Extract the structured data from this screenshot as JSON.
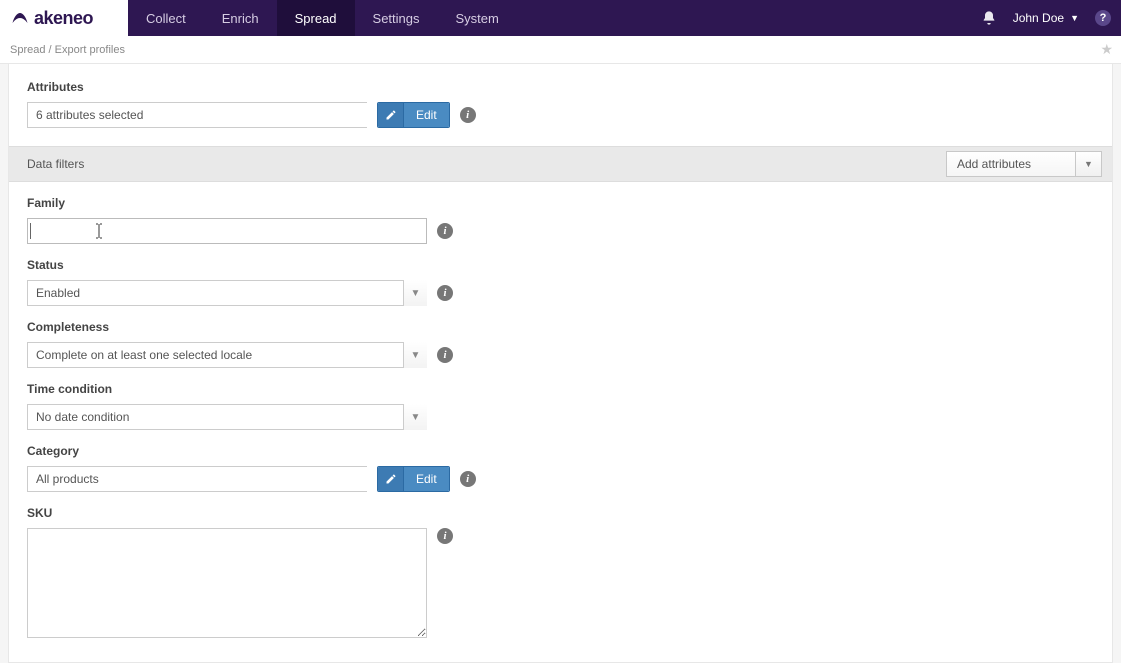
{
  "brand": "akeneo",
  "nav": {
    "items": [
      "Collect",
      "Enrich",
      "Spread",
      "Settings",
      "System"
    ],
    "active": "Spread"
  },
  "user": {
    "name": "John Doe"
  },
  "breadcrumb": {
    "root": "Spread",
    "page": "Export profiles"
  },
  "attributes": {
    "label": "Attributes",
    "value": "6 attributes selected",
    "edit": "Edit"
  },
  "filters": {
    "title": "Data filters",
    "add_button": "Add attributes"
  },
  "family": {
    "label": "Family",
    "value": ""
  },
  "status": {
    "label": "Status",
    "value": "Enabled"
  },
  "completeness": {
    "label": "Completeness",
    "value": "Complete on at least one selected locale"
  },
  "time_condition": {
    "label": "Time condition",
    "value": "No date condition"
  },
  "category": {
    "label": "Category",
    "value": "All products",
    "edit": "Edit"
  },
  "sku": {
    "label": "SKU",
    "value": ""
  }
}
